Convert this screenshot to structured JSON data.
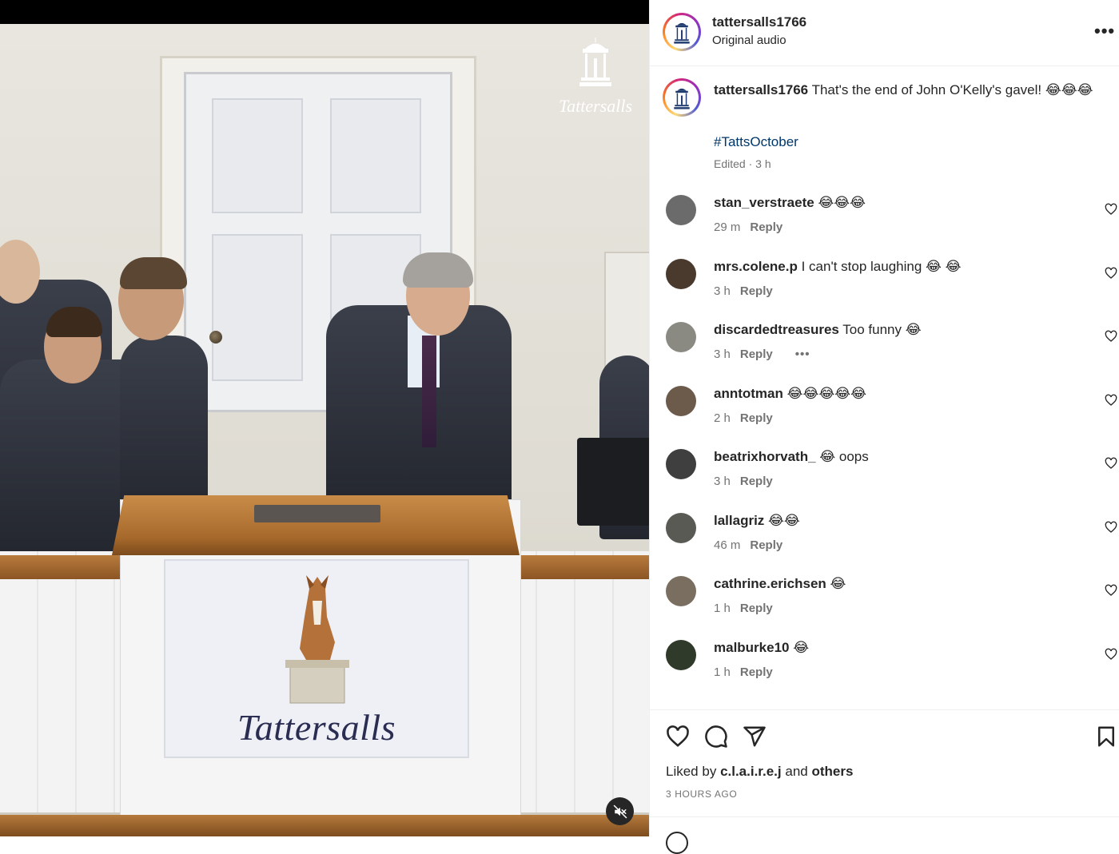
{
  "video": {
    "watermark_text": "Tattersalls",
    "sign_text": "Tattersalls",
    "mute_icon": "speaker-muted-icon"
  },
  "header": {
    "username": "tattersalls1766",
    "subtitle": "Original audio",
    "more_icon": "more-horizontal-icon",
    "more_label": "•••"
  },
  "caption": {
    "username": "tattersalls1766",
    "text": "That's the end of John O'Kelly's gavel! 😂😂😂",
    "hashtag": "#TattsOctober",
    "meta": "Edited · 3 h"
  },
  "comments": [
    {
      "username": "stan_verstraete",
      "text": "😂😂😂",
      "time": "29 m",
      "reply": "Reply",
      "avatar_color": "#6b6b6b"
    },
    {
      "username": "mrs.colene.p",
      "text": "I can't stop laughing 😂 😂",
      "time": "3 h",
      "reply": "Reply",
      "avatar_color": "#4a3a2e"
    },
    {
      "username": "discardedtreasures",
      "text": "Too funny 😂",
      "time": "3 h",
      "reply": "Reply",
      "dots": "•••",
      "avatar_color": "#8a8a82"
    },
    {
      "username": "anntotman",
      "text": "😂😂😂😂😂",
      "time": "2 h",
      "reply": "Reply",
      "avatar_color": "#6c5a4a"
    },
    {
      "username": "beatrixhorvath_",
      "text": "😂 oops",
      "time": "3 h",
      "reply": "Reply",
      "avatar_color": "#3f3f3f"
    },
    {
      "username": "lallagriz",
      "text": "😂😂",
      "time": "46 m",
      "reply": "Reply",
      "avatar_color": "#5a5a55"
    },
    {
      "username": "cathrine.erichsen",
      "text": "😂",
      "time": "1 h",
      "reply": "Reply",
      "avatar_color": "#7a6e60"
    },
    {
      "username": "malburke10",
      "text": "😂",
      "time": "1 h",
      "reply": "Reply",
      "avatar_color": "#2f3a2a"
    }
  ],
  "actions": {
    "like_icon": "heart-icon",
    "comment_icon": "comment-icon",
    "share_icon": "paper-plane-icon",
    "save_icon": "bookmark-icon",
    "liked_prefix": "Liked by",
    "liked_user": "c.l.a.i.r.e.j",
    "liked_and": "and",
    "liked_others": "others",
    "time_ago": "3 HOURS AGO"
  },
  "colors": {
    "text_primary": "#262626",
    "text_secondary": "#737373",
    "hashtag": "#00376b",
    "divider": "#efefef"
  }
}
